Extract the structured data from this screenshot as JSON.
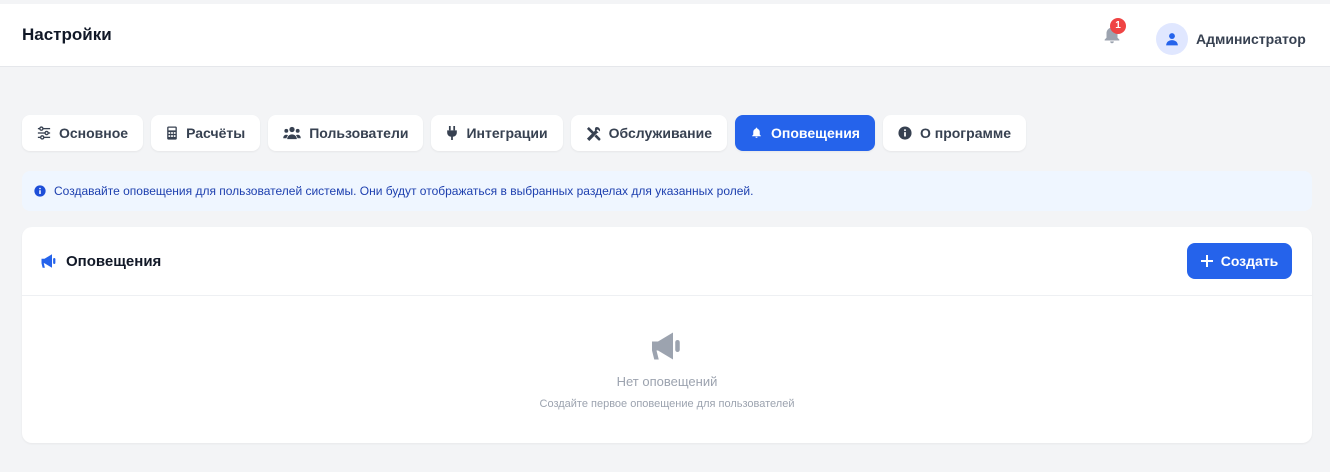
{
  "header": {
    "title": "Настройки",
    "notification_count": "1",
    "user_name": "Администратор"
  },
  "tabs": [
    {
      "label": "Основное",
      "icon": "sliders-icon"
    },
    {
      "label": "Расчёты",
      "icon": "calculator-icon"
    },
    {
      "label": "Пользователи",
      "icon": "users-icon"
    },
    {
      "label": "Интеграции",
      "icon": "plug-icon"
    },
    {
      "label": "Обслуживание",
      "icon": "tools-icon"
    },
    {
      "label": "Оповещения",
      "icon": "bell-icon",
      "active": true
    },
    {
      "label": "О программе",
      "icon": "info-circle-icon"
    }
  ],
  "info_banner": {
    "text": "Создавайте оповещения для пользователей системы. Они будут отображаться в выбранных разделах для указанных ролей."
  },
  "card": {
    "title": "Оповещения",
    "create_label": "Создать",
    "empty_title": "Нет оповещений",
    "empty_subtitle": "Создайте первое оповещение для пользователей"
  },
  "colors": {
    "accent": "#2563eb",
    "badge": "#ef4444",
    "background": "#f3f4f6",
    "info_bg": "#eff6ff",
    "info_text": "#1e40af"
  }
}
